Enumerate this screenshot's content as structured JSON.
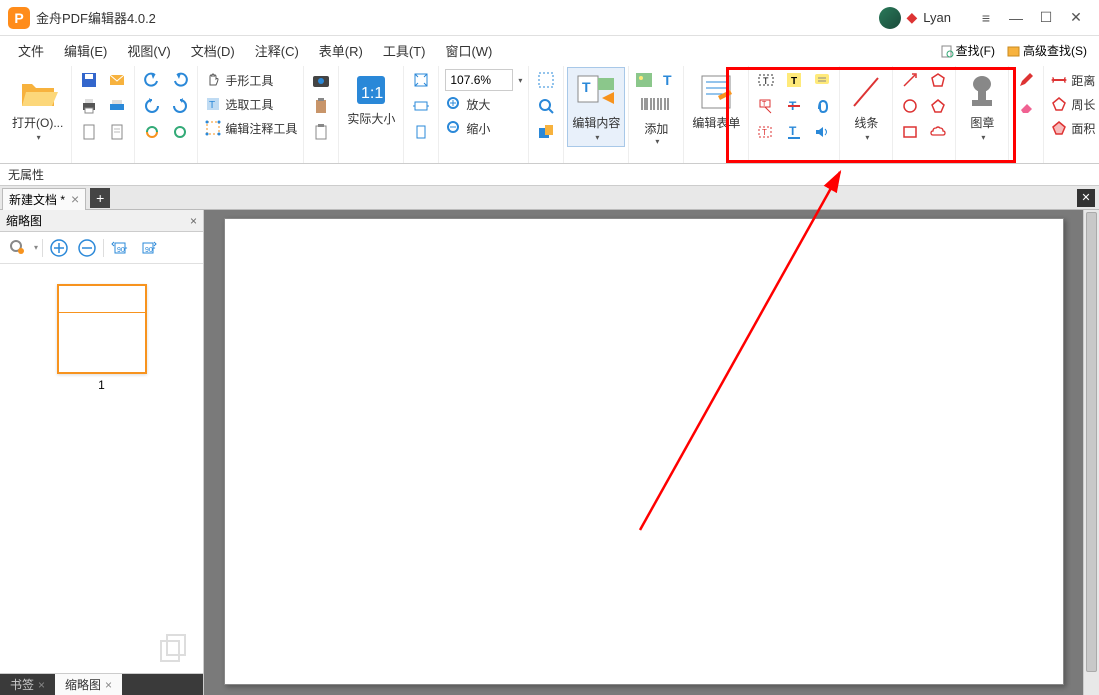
{
  "app": {
    "icon_letter": "P",
    "title": "金舟PDF编辑器4.0.2",
    "username": "Lyan"
  },
  "menu": {
    "file": "文件",
    "edit": "编辑(E)",
    "view": "视图(V)",
    "document": "文档(D)",
    "comment": "注释(C)",
    "form": "表单(R)",
    "tools": "工具(T)",
    "window": "窗口(W)"
  },
  "search": {
    "find": "查找(F)",
    "adv_find": "高级查找(S)"
  },
  "ribbon": {
    "open": "打开(O)...",
    "hand_tool": "手形工具",
    "select_tool": "选取工具",
    "edit_annot_tool": "编辑注释工具",
    "actual_size": "实际大小",
    "zoom_value": "107.6%",
    "zoom_in": "放大",
    "zoom_out": "缩小",
    "edit_content": "编辑内容",
    "add": "添加",
    "edit_form": "编辑表单",
    "lines": "线条",
    "stamp": "图章",
    "distance": "距离",
    "perimeter": "周长",
    "area": "面积"
  },
  "propbar": {
    "text": "无属性"
  },
  "doc_tab": {
    "name": "新建文档 *"
  },
  "sidebar": {
    "title": "缩略图",
    "thumb_label": "1",
    "tabs": {
      "bookmark": "书签",
      "thumbs": "缩略图"
    }
  }
}
